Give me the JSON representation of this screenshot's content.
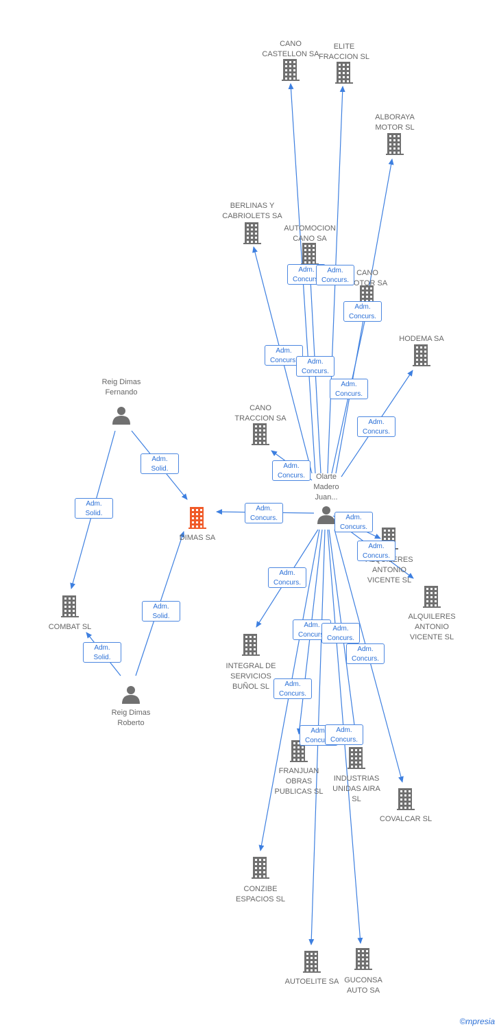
{
  "colors": {
    "edge": "#3d7fe0",
    "node": "#707070",
    "highlight": "#f05a28"
  },
  "nodes": [
    {
      "id": "olarte",
      "type": "person",
      "label": [
        "Olarte",
        "Madero",
        "Juan..."
      ]
    },
    {
      "id": "cano_castellon",
      "type": "company",
      "label": [
        "CANO",
        "CASTELLON SA"
      ]
    },
    {
      "id": "elite",
      "type": "company",
      "label": [
        "ELITE",
        "FRACCION SL"
      ]
    },
    {
      "id": "alboraya",
      "type": "company",
      "label": [
        "ALBORAYA",
        "MOTOR SL"
      ]
    },
    {
      "id": "berlinas",
      "type": "company",
      "label": [
        "BERLINAS Y",
        "CABRIOLETS SA"
      ]
    },
    {
      "id": "automocion",
      "type": "company",
      "label": [
        "AUTOMOCION",
        "CANO SA"
      ]
    },
    {
      "id": "cano_motor",
      "type": "company",
      "label": [
        "CANO",
        "MOTOR SA"
      ]
    },
    {
      "id": "hodema",
      "type": "company",
      "label": [
        "HODEMA SA"
      ]
    },
    {
      "id": "cano_traccion",
      "type": "company",
      "label": [
        "CANO",
        "TRACCION SA"
      ]
    },
    {
      "id": "dimas",
      "type": "company",
      "highlight": true,
      "label": [
        "DIMAS SA"
      ]
    },
    {
      "id": "alquileres1",
      "type": "company",
      "label": [
        "ALQUILERES",
        "ANTONIO",
        "VICENTE SL"
      ]
    },
    {
      "id": "alquileres2",
      "type": "company",
      "label": [
        "ALQUILERES",
        "ANTONIO",
        "VICENTE SL"
      ]
    },
    {
      "id": "integral",
      "type": "company",
      "label": [
        "INTEGRAL DE",
        "SERVICIOS",
        "BUÑOL SL"
      ]
    },
    {
      "id": "franjuan",
      "type": "company",
      "label": [
        "FRANJUAN",
        "OBRAS",
        "PUBLICAS SL"
      ]
    },
    {
      "id": "industrias",
      "type": "company",
      "label": [
        "INDUSTRIAS",
        "UNIDAS AIRA",
        "SL"
      ]
    },
    {
      "id": "covalcar",
      "type": "company",
      "label": [
        "COVALCAR SL"
      ]
    },
    {
      "id": "conzibe",
      "type": "company",
      "label": [
        "CONZIBE",
        "ESPACIOS SL"
      ]
    },
    {
      "id": "autoelite",
      "type": "company",
      "label": [
        "AUTOELITE SA"
      ]
    },
    {
      "id": "guconsa",
      "type": "company",
      "label": [
        "GUCONSA",
        "AUTO SA"
      ]
    },
    {
      "id": "combat",
      "type": "company",
      "label": [
        "COMBAT SL"
      ]
    },
    {
      "id": "fernando",
      "type": "person",
      "label": [
        "Reig Dimas",
        "Fernando"
      ]
    },
    {
      "id": "roberto",
      "type": "person",
      "label": [
        "Reig Dimas",
        "Roberto"
      ]
    }
  ],
  "edges": [
    {
      "from": "olarte",
      "to": "cano_castellon",
      "label": [
        "Adm.",
        "Concurs."
      ]
    },
    {
      "from": "olarte",
      "to": "elite",
      "label": [
        "Adm.",
        "Concurs."
      ]
    },
    {
      "from": "olarte",
      "to": "alboraya",
      "label": [
        "Adm.",
        "Concurs."
      ]
    },
    {
      "from": "olarte",
      "to": "berlinas",
      "label": [
        "Adm.",
        "Concurs."
      ]
    },
    {
      "from": "olarte",
      "to": "automocion",
      "label": [
        "Adm.",
        "Concurs."
      ]
    },
    {
      "from": "olarte",
      "to": "cano_motor",
      "label": [
        "Adm.",
        "Concurs."
      ]
    },
    {
      "from": "olarte",
      "to": "hodema",
      "label": [
        "Adm.",
        "Concurs."
      ]
    },
    {
      "from": "olarte",
      "to": "cano_traccion",
      "label": [
        "Adm.",
        "Concurs."
      ]
    },
    {
      "from": "olarte",
      "to": "dimas",
      "label": [
        "Adm.",
        "Concurs."
      ]
    },
    {
      "from": "olarte",
      "to": "alquileres1",
      "label": [
        "Adm.",
        "Concurs."
      ]
    },
    {
      "from": "olarte",
      "to": "alquileres2",
      "label": [
        "Adm.",
        "Concurs."
      ]
    },
    {
      "from": "olarte",
      "to": "integral",
      "label": [
        "Adm.",
        "Concurs."
      ]
    },
    {
      "from": "olarte",
      "to": "franjuan",
      "label": [
        "Adm.",
        "Concurs."
      ]
    },
    {
      "from": "olarte",
      "to": "industrias",
      "label": [
        "Adm.",
        "Concurs."
      ]
    },
    {
      "from": "olarte",
      "to": "covalcar",
      "label": [
        "Adm.",
        "Concurs."
      ]
    },
    {
      "from": "olarte",
      "to": "conzibe",
      "label": [
        "Adm.",
        "Concurs."
      ]
    },
    {
      "from": "olarte",
      "to": "autoelite",
      "label": [
        "Adm.",
        "Concurs."
      ]
    },
    {
      "from": "olarte",
      "to": "guconsa",
      "label": [
        "Adm.",
        "Concurs."
      ]
    },
    {
      "from": "fernando",
      "to": "dimas",
      "label": [
        "Adm.",
        "Solid."
      ]
    },
    {
      "from": "fernando",
      "to": "combat",
      "label": [
        "Adm.",
        "Solid."
      ]
    },
    {
      "from": "roberto",
      "to": "dimas",
      "label": [
        "Adm.",
        "Solid."
      ]
    },
    {
      "from": "roberto",
      "to": "combat",
      "label": [
        "Adm.",
        "Solid."
      ]
    }
  ],
  "footer": {
    "brand": "©mpresia"
  }
}
